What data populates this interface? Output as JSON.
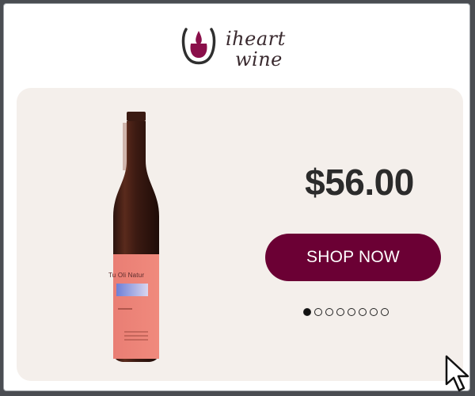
{
  "brand": {
    "logo_line_1": "iheart",
    "logo_line_2": "wine",
    "accent": "#6b0034",
    "logo_color": "#8a0f4a"
  },
  "product": {
    "label_name": "Tu Oli Natur",
    "price": "$56.00"
  },
  "cta": {
    "label": "SHOP NOW"
  },
  "carousel": {
    "total": 8,
    "active_index": 0
  },
  "icons": [
    "glass-drop-logo-icon",
    "mouse-pointer-icon"
  ]
}
